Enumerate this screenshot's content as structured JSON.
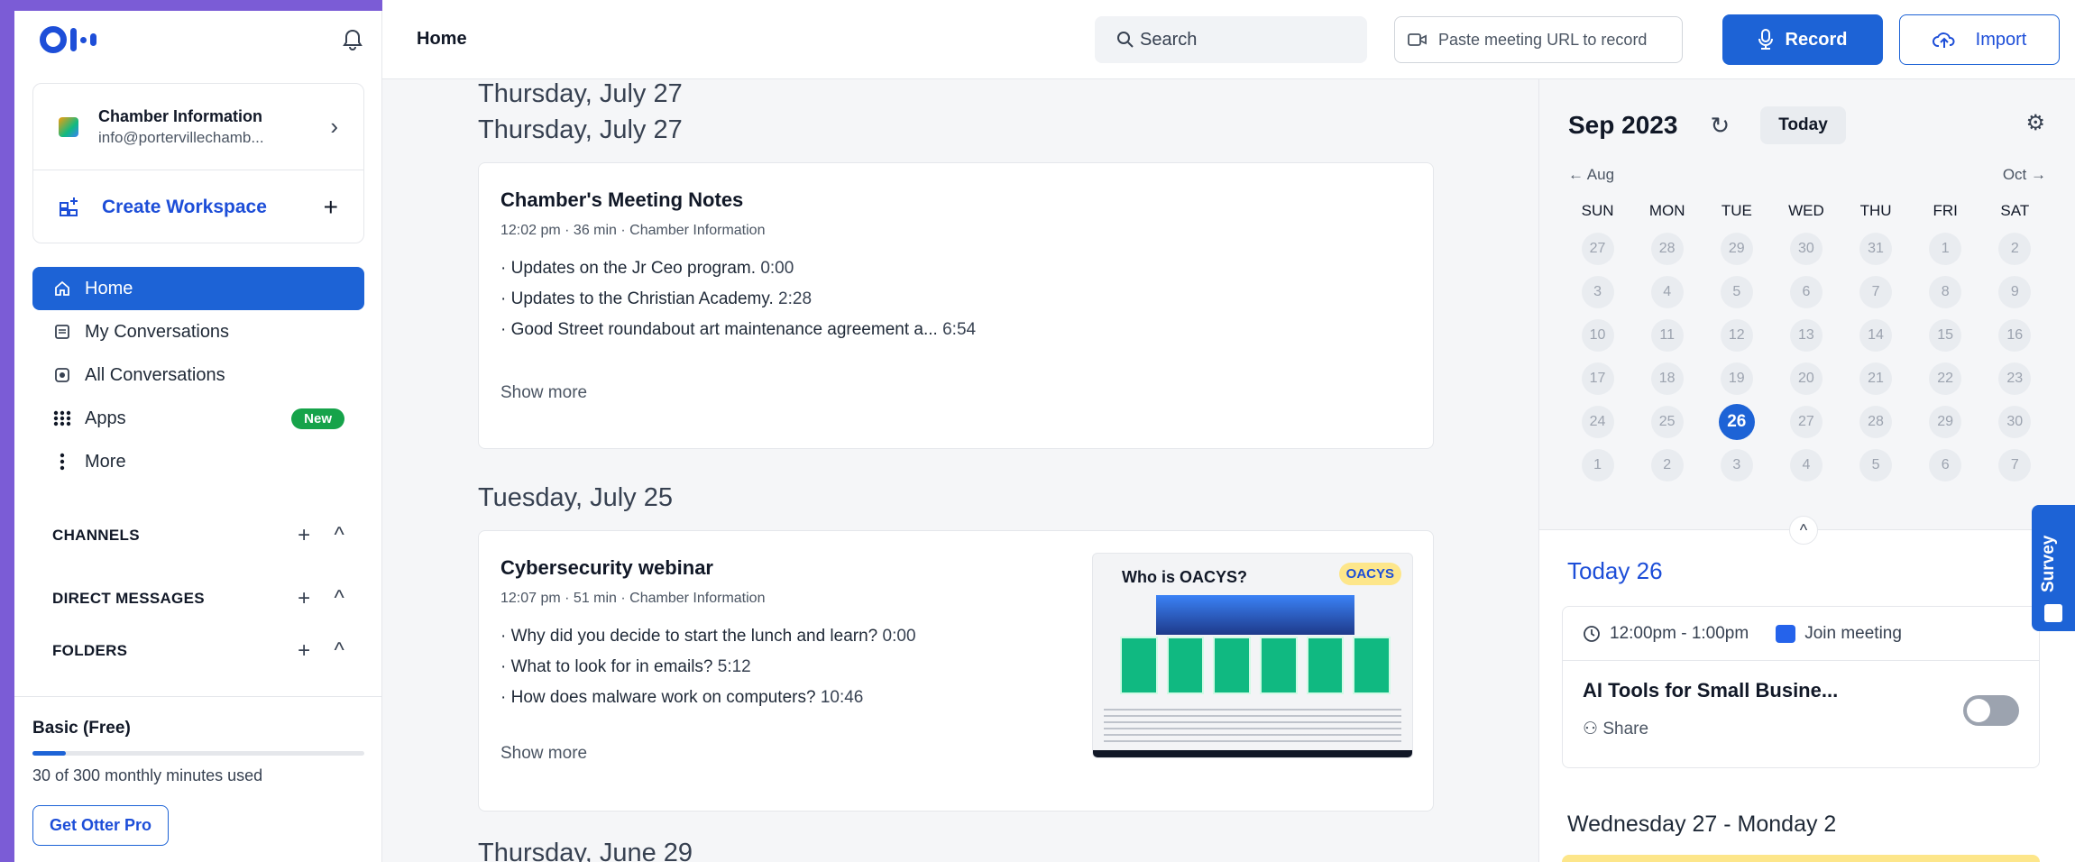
{
  "app": {
    "page_title": "Home"
  },
  "sidebar": {
    "workspace": {
      "name": "Chamber Information",
      "email": "info@portervillechamb..."
    },
    "create_workspace_label": "Create Workspace",
    "nav": [
      {
        "label": "Home",
        "icon": "home-icon",
        "active": true
      },
      {
        "label": "My Conversations",
        "icon": "document-icon"
      },
      {
        "label": "All Conversations",
        "icon": "conversations-icon"
      },
      {
        "label": "Apps",
        "icon": "apps-grid-icon",
        "badge": "New"
      },
      {
        "label": "More",
        "icon": "more-vertical-icon"
      }
    ],
    "sections": [
      {
        "label": "CHANNELS"
      },
      {
        "label": "DIRECT MESSAGES"
      },
      {
        "label": "FOLDERS"
      }
    ],
    "plan": {
      "title": "Basic (Free)",
      "usage": "30 of 300 monthly minutes used",
      "used_fraction": 0.1,
      "cta": "Get Otter Pro"
    }
  },
  "topbar": {
    "search_placeholder": "Search",
    "url_placeholder": "Paste meeting URL to record",
    "record_label": "Record",
    "import_label": "Import"
  },
  "feed": {
    "groups": [
      {
        "date": "Thursday, July 27",
        "card": {
          "title": "Chamber's Meeting Notes",
          "meta": "12:02 pm · 36 min · Chamber Information",
          "bullets": [
            {
              "text": "Updates on the Jr Ceo program.",
              "ts": "0:00"
            },
            {
              "text": "Updates to the Christian Academy.",
              "ts": "2:28"
            },
            {
              "text": "Good Street roundabout art maintenance agreement a...",
              "ts": "6:54"
            }
          ],
          "show_more": "Show more"
        }
      },
      {
        "date": "Tuesday, July 25",
        "card": {
          "title": "Cybersecurity webinar",
          "meta": "12:07 pm · 51 min · Chamber Information",
          "bullets": [
            {
              "text": "Why did you decide to start the lunch and learn?",
              "ts": "0:00"
            },
            {
              "text": "What to look for in emails?",
              "ts": "5:12"
            },
            {
              "text": "How does malware work on computers?",
              "ts": "10:46"
            }
          ],
          "show_more": "Show more",
          "thumbnail": {
            "title": "Who is OACYS?",
            "logo": "OACYS"
          }
        }
      },
      {
        "date": "Thursday, June 29"
      }
    ]
  },
  "calendar": {
    "month": "Sep 2023",
    "today_label": "Today",
    "prev": "← Aug",
    "next": "Oct →",
    "dow": [
      "SUN",
      "MON",
      "TUE",
      "WED",
      "THU",
      "FRI",
      "SAT"
    ],
    "weeks": [
      [
        "27",
        "28",
        "29",
        "30",
        "31",
        "1",
        "2"
      ],
      [
        "3",
        "4",
        "5",
        "6",
        "7",
        "8",
        "9"
      ],
      [
        "10",
        "11",
        "12",
        "13",
        "14",
        "15",
        "16"
      ],
      [
        "17",
        "18",
        "19",
        "20",
        "21",
        "22",
        "23"
      ],
      [
        "24",
        "25",
        "26",
        "27",
        "28",
        "29",
        "30"
      ],
      [
        "1",
        "2",
        "3",
        "4",
        "5",
        "6",
        "7"
      ]
    ],
    "selected": {
      "week": 4,
      "day": 2
    }
  },
  "today_panel": {
    "title": "Today 26",
    "event": {
      "time": "12:00pm - 1:00pm",
      "join_label": "Join meeting",
      "title": "AI Tools for Small Busine...",
      "share_label": "Share"
    },
    "upcoming_title": "Wednesday 27 - Monday 2"
  },
  "survey": {
    "label": "Survey"
  },
  "colors": {
    "accent": "#1d63d6",
    "frame": "#7b5cd6",
    "badge_new": "#16a34a"
  }
}
